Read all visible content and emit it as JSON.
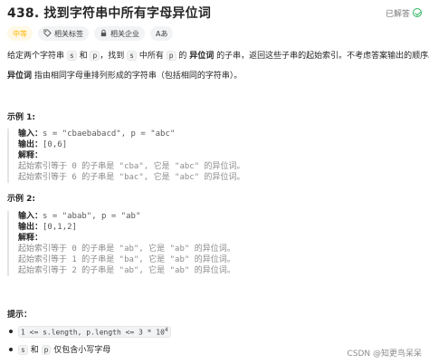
{
  "header": {
    "title": "438. 找到字符串中所有字母异位词",
    "status": "已解答"
  },
  "tags": [
    {
      "label": "中等",
      "icon": ""
    },
    {
      "label": "相关标签",
      "icon": "tag-icon"
    },
    {
      "label": "相关企业",
      "icon": "lock-icon"
    },
    {
      "label": "Aあ",
      "icon": "translate-icon"
    }
  ],
  "description": {
    "line1_a": "给定两个字符串 ",
    "s": "s",
    "and": " 和 ",
    "p": "p",
    "line1_b": "，找到 ",
    "s2": "s",
    "line1_c": " 中所有 ",
    "p2": "p",
    "line1_d": " 的 ",
    "bold": "异位词",
    "line1_e": " 的子串，返回这些子串的起始索引。不考虑答案输出的顺序。",
    "line2_bold": "异位词",
    "line2": " 指由相同字母重排列形成的字符串（包括相同的字符串）。"
  },
  "examples": [
    {
      "title": "示例 1:",
      "input_label": "输入：",
      "input": "s = \"cbaebabacd\", p = \"abc\"",
      "output_label": "输出：",
      "output": "[0,6]",
      "explain_label": "解释：",
      "explain": [
        "起始索引等于 0 的子串是 \"cba\", 它是 \"abc\" 的异位词。",
        "起始索引等于 6 的子串是 \"bac\", 它是 \"abc\" 的异位词。"
      ]
    },
    {
      "title": "示例 2:",
      "input_label": "输入：",
      "input": "s = \"abab\", p = \"ab\"",
      "output_label": "输出：",
      "output": "[0,1,2]",
      "explain_label": "解释：",
      "explain": [
        "起始索引等于 0 的子串是 \"ab\", 它是 \"ab\" 的异位词。",
        "起始索引等于 1 的子串是 \"ba\", 它是 \"ab\" 的异位词。",
        "起始索引等于 2 的子串是 \"ab\", 它是 \"ab\" 的异位词。"
      ]
    }
  ],
  "hints": {
    "title": "提示：",
    "items": [
      {
        "code": "1 <= s.length, p.length <= 3 * 10",
        "sup": "4",
        "text": ""
      },
      {
        "code": "s",
        "mid": " 和 ",
        "code2": "p",
        "text": " 仅包含小写字母"
      }
    ]
  },
  "watermark": "CSDN @知更鸟呆呆",
  "colors": {
    "difficulty": "#ffb800",
    "solved": "#2db55d"
  }
}
